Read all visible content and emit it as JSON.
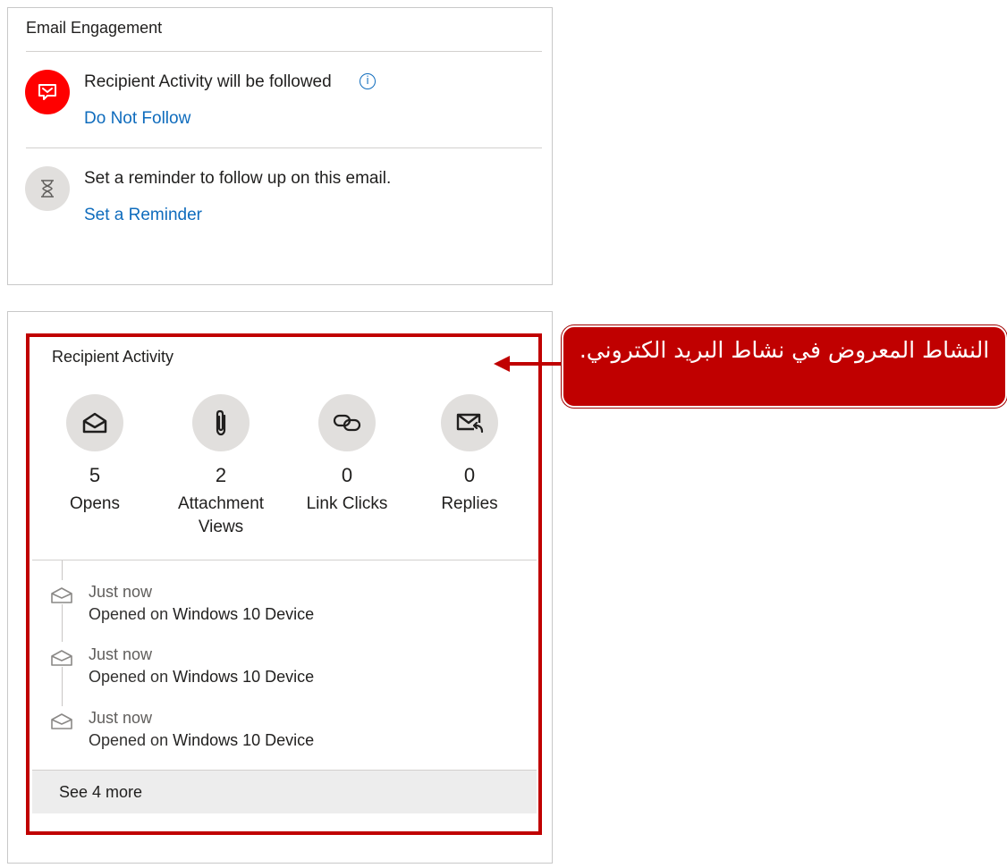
{
  "email_engagement": {
    "title": "Email Engagement",
    "follow": {
      "text": "Recipient Activity will be followed",
      "link": "Do Not Follow",
      "icon": "email-tracking-icon",
      "accent": "#ff0000"
    },
    "reminder": {
      "text": "Set a reminder to follow up on this email.",
      "link": "Set a Reminder",
      "icon": "hourglass-icon"
    }
  },
  "recipient_activity": {
    "title": "Recipient Activity",
    "stats": [
      {
        "value": "5",
        "label": "Opens",
        "icon": "envelope-open-icon"
      },
      {
        "value": "2",
        "label": "Attachment Views",
        "icon": "paperclip-icon"
      },
      {
        "value": "0",
        "label": "Link Clicks",
        "icon": "link-icon"
      },
      {
        "value": "0",
        "label": "Replies",
        "icon": "reply-mail-icon"
      }
    ],
    "timeline": [
      {
        "time": "Just now",
        "prefix": "Opened on",
        "device": "Windows 10 Device"
      },
      {
        "time": "Just now",
        "prefix": "Opened on",
        "device": "Windows 10 Device"
      },
      {
        "time": "Just now",
        "prefix": "Opened on",
        "device": "Windows 10 Device"
      }
    ],
    "see_more": "See 4 more"
  },
  "annotation": {
    "text": "النشاط المعروض في نشاط البريد الكتروني.",
    "color": "#c00000"
  }
}
